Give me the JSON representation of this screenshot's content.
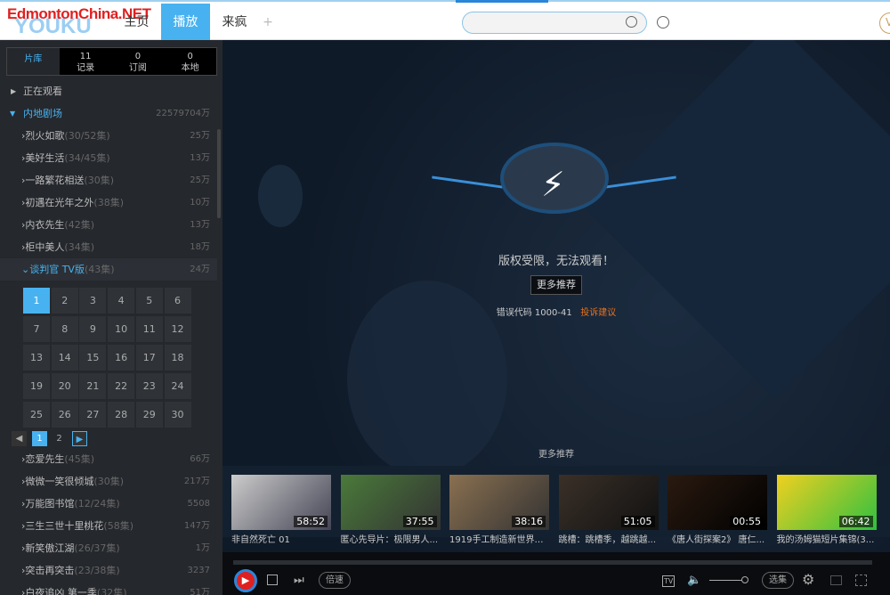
{
  "header": {
    "watermark": "EdmontonChina.NET",
    "logo": "YOUKU",
    "nav": [
      "主页",
      "播放",
      "来疯"
    ],
    "add": "+",
    "search_placeholder": "",
    "vip": "V"
  },
  "sidebar": {
    "tabs": [
      {
        "label": "片库"
      },
      {
        "count": "11",
        "label": "记录"
      },
      {
        "count": "0",
        "label": "订阅"
      },
      {
        "count": "0",
        "label": "本地"
      }
    ],
    "watching": "正在观看",
    "category": {
      "label": "内地剧场",
      "count": "22579704万"
    },
    "shows_top": [
      {
        "name": "烈火如歌",
        "eps": "(30/52集)",
        "views": "25万"
      },
      {
        "name": "美好生活",
        "eps": "(34/45集)",
        "views": "13万"
      },
      {
        "name": "一路繁花相送",
        "eps": "(30集)",
        "views": "25万"
      },
      {
        "name": "初遇在光年之外",
        "eps": "(38集)",
        "views": "10万"
      },
      {
        "name": "内衣先生",
        "eps": "(42集)",
        "views": "13万"
      },
      {
        "name": "柜中美人",
        "eps": "(34集)",
        "views": "18万"
      }
    ],
    "selected_show": {
      "name": "谈判官 TV版",
      "eps": "(43集)",
      "views": "24万"
    },
    "episodes": [
      "1",
      "2",
      "3",
      "4",
      "5",
      "6",
      "7",
      "8",
      "9",
      "10",
      "11",
      "12",
      "13",
      "14",
      "15",
      "16",
      "17",
      "18",
      "19",
      "20",
      "21",
      "22",
      "23",
      "24",
      "25",
      "26",
      "27",
      "28",
      "29",
      "30"
    ],
    "current_episode": "1",
    "pages": [
      "1",
      "2"
    ],
    "shows_bottom": [
      {
        "name": "恋爱先生",
        "eps": "(45集)",
        "views": "66万"
      },
      {
        "name": "微微一笑很倾城",
        "eps": "(30集)",
        "views": "217万"
      },
      {
        "name": "万能图书馆",
        "eps": "(12/24集)",
        "views": "5508"
      },
      {
        "name": "三生三世十里桃花",
        "eps": "(58集)",
        "views": "147万"
      },
      {
        "name": "新笑傲江湖",
        "eps": "(26/37集)",
        "views": "1万"
      },
      {
        "name": "突击再突击",
        "eps": "(23/38集)",
        "views": "3237"
      },
      {
        "name": "白夜追凶 第一季",
        "eps": "(32集)",
        "views": "51万"
      }
    ]
  },
  "player": {
    "error_title": "版权受限，无法观看！",
    "more_button": "更多推荐",
    "error_code": "错误代码 1000-41",
    "report_link": "投诉建议",
    "rec_title": "更多推荐",
    "recs": [
      {
        "title": "非自然死亡 01",
        "duration": "58:52"
      },
      {
        "title": "匿心先导片：极限男人...",
        "duration": "37:55"
      },
      {
        "title": "1919手工制造新世界（...",
        "duration": "38:16"
      },
      {
        "title": "跳槽：跳槽季，越跳越...",
        "duration": "51:05"
      },
      {
        "title": "《唐人街探案2》 唐仁...",
        "duration": "00:55"
      },
      {
        "title": "我的汤姆猫短片集锦(3...",
        "duration": "06:42"
      }
    ],
    "controls": {
      "speed": "倍速",
      "episodes": "选集",
      "tv": "TV"
    }
  }
}
